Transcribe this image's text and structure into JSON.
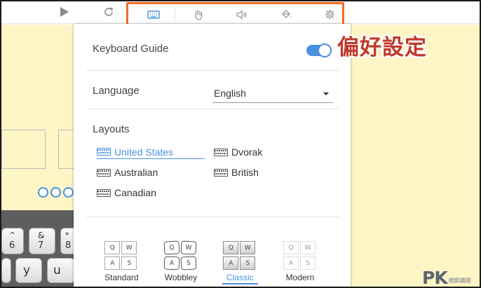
{
  "toolbar": {
    "play_icon": "play-icon",
    "reload_icon": "reload-icon",
    "group_icons": [
      "keyboard-icon",
      "hand-icon",
      "sound-icon",
      "paint-bucket-icon",
      "gear-icon"
    ]
  },
  "background": {
    "keys": {
      "row1": [
        "6",
        "&\n7",
        "8"
      ],
      "row1_top": [
        "^",
        "*"
      ],
      "row2": [
        "y",
        "u"
      ]
    }
  },
  "settings": {
    "keyboard_guide_label": "Keyboard Guide",
    "keyboard_guide_on": true,
    "language_label": "Language",
    "language_value": "English",
    "layouts_label": "Layouts",
    "layouts": [
      {
        "label": "United States",
        "selected": true
      },
      {
        "label": "Dvorak",
        "selected": false
      },
      {
        "label": "Australian",
        "selected": false
      },
      {
        "label": "British",
        "selected": false
      },
      {
        "label": "Canadian",
        "selected": false
      }
    ],
    "styles": [
      {
        "label": "Standard",
        "keys": [
          "Q",
          "W",
          "A",
          "S"
        ],
        "selected": false
      },
      {
        "label": "Wobbley",
        "keys": [
          "Q",
          "W",
          "A",
          "S"
        ],
        "selected": false
      },
      {
        "label": "Classic",
        "keys": [
          "Q",
          "W",
          "A",
          "S"
        ],
        "selected": true
      },
      {
        "label": "Modern",
        "keys": [
          "Q",
          "W",
          "A",
          "S"
        ],
        "selected": false
      }
    ]
  },
  "callout_text": "偏好設定",
  "watermark": {
    "brand": "PK",
    "sub": "痞凱踏踏"
  },
  "colors": {
    "accent": "#4a90e2",
    "highlight": "#f26b22",
    "callout": "#c0392b",
    "background": "#fdf5c6"
  }
}
